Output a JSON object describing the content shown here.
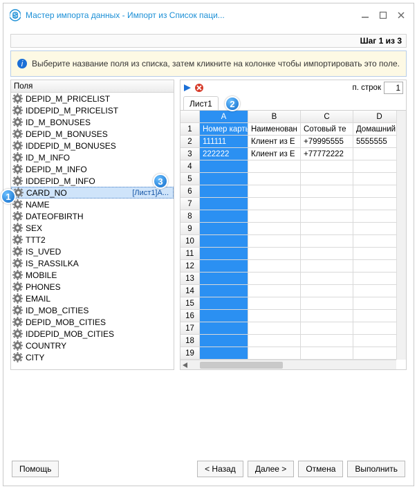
{
  "window": {
    "title": "Мастер импорта данных - Импорт из Список паци..."
  },
  "step_label": "Шаг 1 из 3",
  "hint": "Выберите название поля из списка, затем кликните на колонке чтобы импортировать это поле.",
  "fields_header": "Поля",
  "fields": [
    {
      "name": "DEPID_M_PRICELIST"
    },
    {
      "name": "IDDEPID_M_PRICELIST"
    },
    {
      "name": "ID_M_BONUSES"
    },
    {
      "name": "DEPID_M_BONUSES"
    },
    {
      "name": "IDDEPID_M_BONUSES"
    },
    {
      "name": "ID_M_INFO"
    },
    {
      "name": "DEPID_M_INFO"
    },
    {
      "name": "IDDEPID_M_INFO"
    },
    {
      "name": "CARD_NO",
      "mapped": "[Лист1]A..."
    },
    {
      "name": "NAME"
    },
    {
      "name": "DATEOFBIRTH"
    },
    {
      "name": "SEX"
    },
    {
      "name": "TTT2"
    },
    {
      "name": "IS_UVED"
    },
    {
      "name": "IS_RASSILKA"
    },
    {
      "name": "MOBILE"
    },
    {
      "name": "PHONES"
    },
    {
      "name": "EMAIL"
    },
    {
      "name": "ID_MOB_CITIES"
    },
    {
      "name": "DEPID_MOB_CITIES"
    },
    {
      "name": "IDDEPID_MOB_CITIES"
    },
    {
      "name": "COUNTRY"
    },
    {
      "name": "CITY"
    }
  ],
  "selected_field_index": 8,
  "rowcount_label": "п. строк",
  "rowcount_value": "1",
  "tab_label": "Лист1",
  "columns": [
    "A",
    "B",
    "C",
    "D"
  ],
  "data_header_row": [
    "Номер карты",
    "Наименован",
    "Сотовый те",
    "Домашний т"
  ],
  "data_rows": [
    [
      "111111",
      "Клиент из E",
      "+79995555",
      "5555555"
    ],
    [
      "222222",
      "Клиент из E",
      "+77772222",
      ""
    ]
  ],
  "visible_row_numbers": 19,
  "buttons": {
    "help": "Помощь",
    "back": "< Назад",
    "next": "Далее >",
    "cancel": "Отмена",
    "run": "Выполнить"
  },
  "callouts": {
    "c1": "1",
    "c2": "2",
    "c3": "3"
  }
}
